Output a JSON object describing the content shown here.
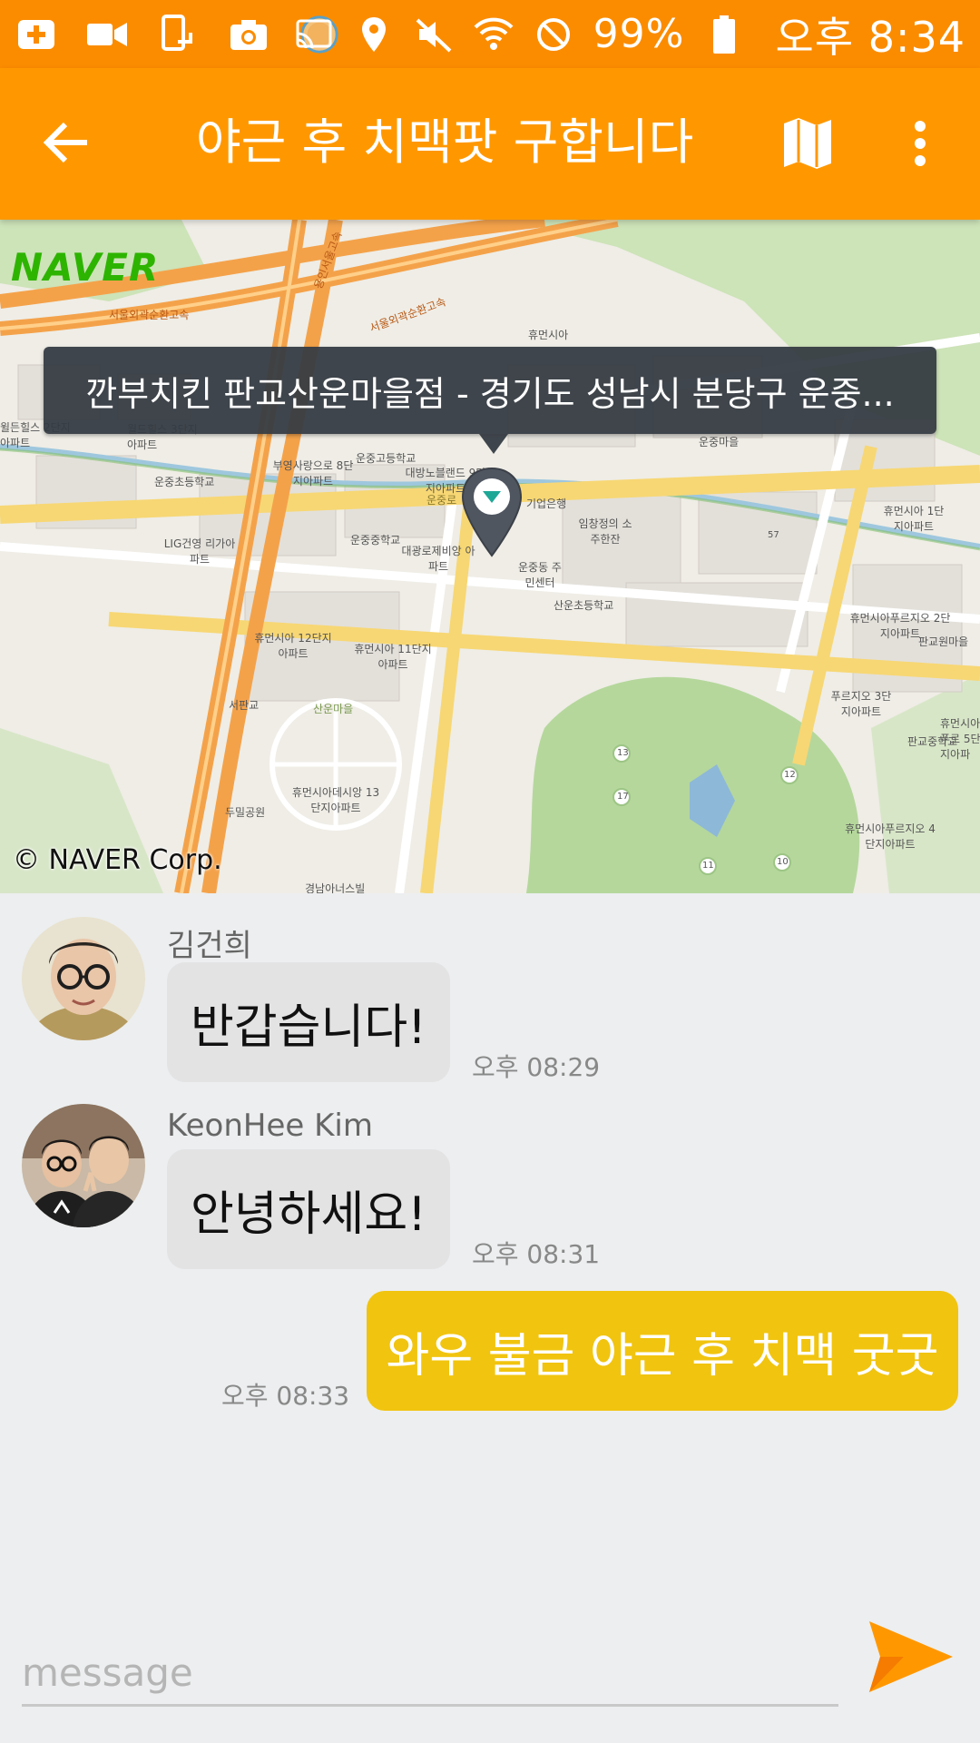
{
  "status_bar": {
    "battery_text": "99%",
    "clock": "오후 8:34",
    "left_icons": [
      "add-icon",
      "video-icon",
      "screen-share-icon",
      "camera-icon",
      "circle-avatar-icon"
    ],
    "right_icons": [
      "cast-icon",
      "location-icon",
      "mute-icon",
      "wifi-icon",
      "block-icon",
      "battery-icon"
    ]
  },
  "app_bar": {
    "title": "야근 후 치맥팟 구합니다",
    "back_icon": "arrow-back-icon",
    "map_icon": "map-icon",
    "more_icon": "more-vert-icon"
  },
  "map": {
    "logo": "NAVER",
    "credit": "© NAVER Corp.",
    "tooltip": "깐부치킨 판교산운마을점 - 경기도 성남시 분당구 운중...",
    "labels": [
      "서울외곽순환고속",
      "서울외곽순환고속",
      "용인서울고속",
      "휴먼시아",
      "윌든힐스 2단지아파트",
      "월드힐스 3단지아파트",
      "운중초등학교",
      "LIG건영 리가아파트",
      "부영사랑으로 8단지아파트",
      "운중고등학교",
      "대방노블랜드 9단지아파트",
      "운중중학교",
      "대광로제비앙 아파트",
      "운중로",
      "기업은행",
      "임창정의 소주한잔",
      "운중동 주민센터",
      "산운초등학교",
      "운중마을",
      "휴먼시아 1단지아파트",
      "휴먼시아 12단지아파트",
      "휴먼시아 11단지아파트",
      "서판교",
      "산운마을",
      "휴먼시아데시앙 13단지아파트",
      "두밀공원",
      "경남아너스빌",
      "휴먼시아푸르지오 2단지아파트",
      "판교원마을",
      "푸르지오 3단지아파트",
      "휴먼시아푸르 5단지아파",
      "판교중학교",
      "휴먼시아푸르지오 4단지아파트",
      "57",
      "13",
      "17",
      "12",
      "11",
      "10"
    ]
  },
  "messages": [
    {
      "sender": "김건희",
      "text": "반갑습니다!",
      "time": "오후 08:29"
    },
    {
      "sender": "KeonHee  Kim",
      "text": "안녕하세요!",
      "time": "오후 08:31"
    }
  ],
  "my_message": {
    "text": "와우 불금 야근 후 치맥 굿굿",
    "time": "오후 08:33"
  },
  "input": {
    "placeholder": "message",
    "value": ""
  },
  "colors": {
    "status_bar": "#FB8C00",
    "app_bar": "#FF9800",
    "my_bubble": "#F1C40F",
    "other_bubble": "#E3E3E4",
    "send_button": "#FF9800"
  }
}
